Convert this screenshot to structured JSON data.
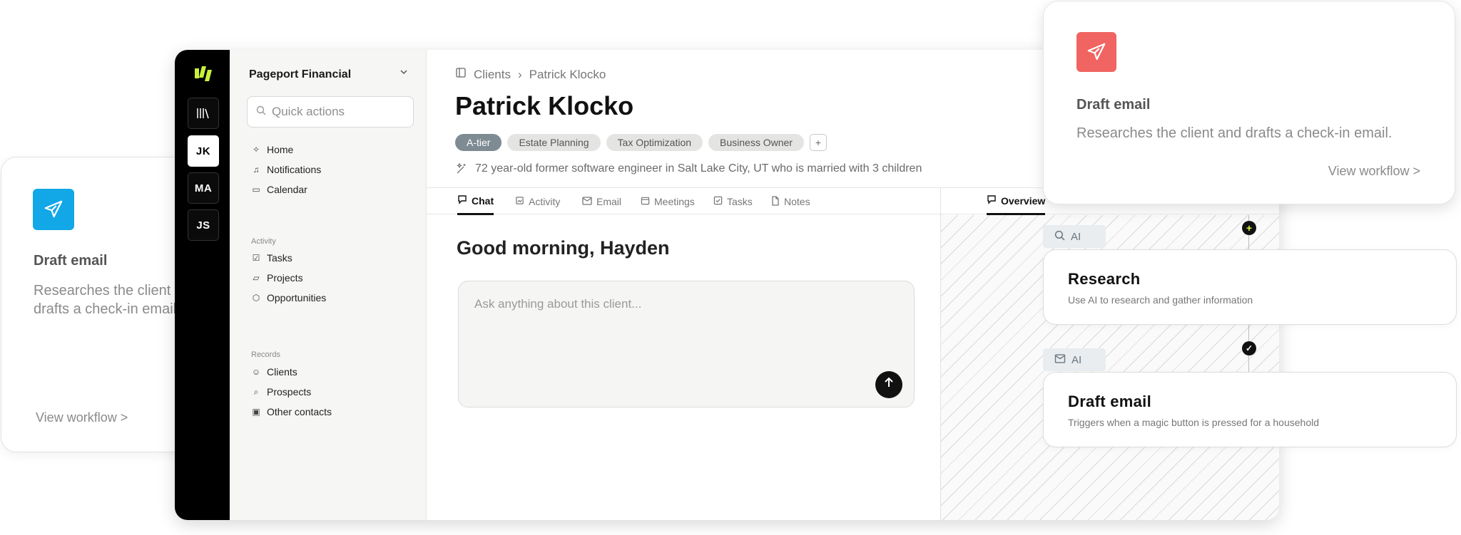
{
  "left_card": {
    "title": "Draft email",
    "description": "Researches the client and drafts a check-in email.",
    "link": "View workflow >",
    "icon": "paper-plane-icon",
    "color": "#12a7e6"
  },
  "rail": {
    "accounts": [
      "JK",
      "MA",
      "JS"
    ],
    "logo_color": "#c9f23b"
  },
  "sidebar": {
    "org_name": "Pageport Financial",
    "search_placeholder": "Quick actions",
    "main_items": [
      {
        "label": "Home",
        "icon": "wand-icon"
      },
      {
        "label": "Notifications",
        "icon": "bell-icon"
      },
      {
        "label": "Calendar",
        "icon": "calendar-icon"
      }
    ],
    "activity_heading": "Activity",
    "activity_items": [
      {
        "label": "Tasks",
        "icon": "checkbox-icon"
      },
      {
        "label": "Projects",
        "icon": "folder-icon"
      },
      {
        "label": "Opportunities",
        "icon": "cube-icon"
      }
    ],
    "records_heading": "Records",
    "records_items": [
      {
        "label": "Clients",
        "icon": "users-icon"
      },
      {
        "label": "Prospects",
        "icon": "search-icon"
      },
      {
        "label": "Other contacts",
        "icon": "contact-book-icon"
      }
    ]
  },
  "header": {
    "breadcrumb": [
      "Clients",
      "Patrick Klocko"
    ],
    "title": "Patrick Klocko",
    "tags": [
      "A-tier",
      "Estate Planning",
      "Tax Optimization",
      "Business Owner"
    ],
    "add_tag": "+",
    "bio": "72 year-old former software engineer in Salt Lake City, UT who is married with 3 children"
  },
  "tabs": [
    "Chat",
    "Activity",
    "Email",
    "Meetings",
    "Tasks",
    "Notes"
  ],
  "overview_tab": "Overview",
  "chat": {
    "greeting": "Good morning, Hayden",
    "placeholder": "Ask anything about this client..."
  },
  "workflow": {
    "ai_label": "AI",
    "add_node": "+",
    "check_node": "✓",
    "steps": [
      {
        "title": "Research",
        "description": "Use AI to research and gather information",
        "icon": "search-icon"
      },
      {
        "title": "Draft email",
        "description": "Triggers when a magic button is pressed for a household",
        "icon": "mail-icon"
      }
    ]
  },
  "popup": {
    "title": "Draft email",
    "description": "Researches the client and drafts a check-in email.",
    "link": "View workflow >",
    "icon": "paper-plane-icon",
    "color": "#f06461"
  }
}
